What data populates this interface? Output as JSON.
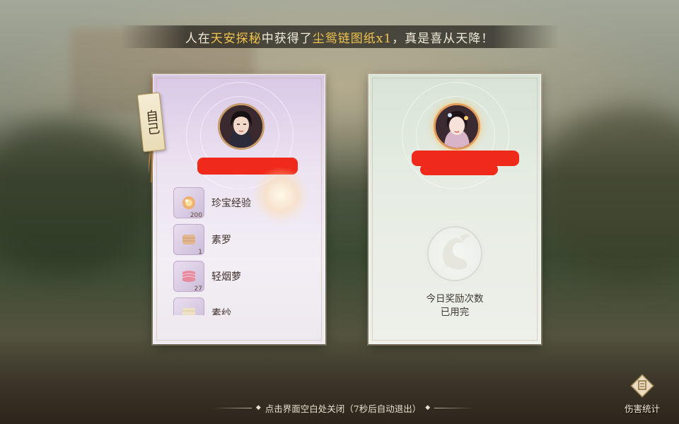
{
  "banner": {
    "part1": "人在",
    "location": "天安探秘",
    "part2": "中获得了",
    "item": "尘鸳链图纸x1",
    "part3": "，真是喜从天降！"
  },
  "self_card": {
    "tag_label": "自己",
    "items": [
      {
        "name": "珍宝经验",
        "qty": "200",
        "icon": "gem-orb-icon",
        "color": "#e8a060"
      },
      {
        "name": "素罗",
        "qty": "1",
        "icon": "cloth-bolt-icon",
        "color": "#e2b892"
      },
      {
        "name": "轻烟萝",
        "qty": "27",
        "icon": "pink-fabric-icon",
        "color": "#e68aa0"
      },
      {
        "name": "素纱",
        "qty": "",
        "icon": "cream-fabric-icon",
        "color": "#efe2c4"
      }
    ]
  },
  "other_card": {
    "empty_line1": "今日奖励次数",
    "empty_line2": "已用完"
  },
  "footer": {
    "hint": "点击界面空白处关闭（7秒后自动退出）",
    "stats_label": "伤害统计"
  }
}
